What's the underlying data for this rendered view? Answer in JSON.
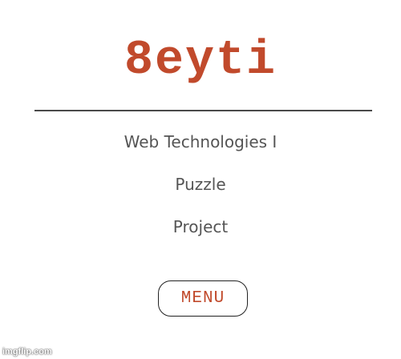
{
  "brand": {
    "logo_text": "8eyti",
    "accent_color": "#c14a2c"
  },
  "nav": {
    "items": [
      {
        "label": "Web Technologies I"
      },
      {
        "label": "Puzzle"
      },
      {
        "label": "Project"
      }
    ],
    "menu_button_label": "MENU"
  },
  "watermark": {
    "text": "imgflip.com"
  }
}
